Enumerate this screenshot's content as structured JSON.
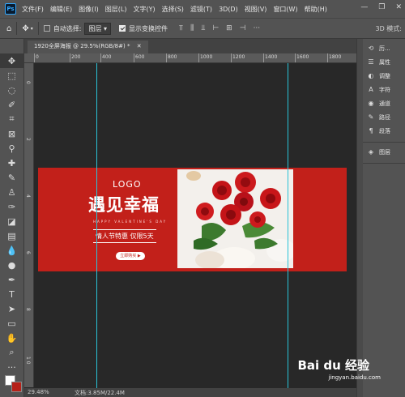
{
  "app": {
    "logo": "Ps"
  },
  "menu": [
    "文件(F)",
    "编辑(E)",
    "图像(I)",
    "图层(L)",
    "文字(Y)",
    "选择(S)",
    "滤镜(T)",
    "3D(D)",
    "视图(V)",
    "窗口(W)",
    "帮助(H)"
  ],
  "window_controls": {
    "minimize": "—",
    "restore": "❐",
    "close": "✕"
  },
  "options": {
    "auto_select_label": "自动选择:",
    "auto_select_checked": false,
    "target_value": "图层",
    "show_transform_label": "显示变换控件",
    "show_transform_checked": true,
    "more": "···",
    "mode_3d": "3D 模式:"
  },
  "document": {
    "tab_title": "1920全屏海报 @ 29.5%(RGB/8#) *",
    "zoom": "29.48%",
    "doc_size": "文档:3.85M/22.4M",
    "ruler_top": [
      "0",
      "200",
      "400",
      "600",
      "800",
      "1000",
      "1200",
      "1400",
      "1600",
      "1800"
    ],
    "ruler_left": [
      "0",
      "2",
      "4",
      "6",
      "8",
      "1 0"
    ]
  },
  "banner": {
    "logo_text": "LOGO",
    "title": "遇见幸福",
    "subtitle": "HAPPY VALENTINE'S DAY",
    "offer": "情人节特惠 仅限5天",
    "button": "立即购买 ▶"
  },
  "colors": {
    "banner_red": "#c2201a",
    "guide": "#29c3d8",
    "foreground": "#ffffff",
    "background": "#b52119"
  },
  "panels": {
    "group1": [
      {
        "icon": "history-icon",
        "glyph": "⟲",
        "label": "历..."
      },
      {
        "icon": "properties-icon",
        "glyph": "☰",
        "label": "属性"
      },
      {
        "icon": "adjustments-icon",
        "glyph": "◐",
        "label": "调整"
      },
      {
        "icon": "character-icon",
        "glyph": "A",
        "label": "字符"
      },
      {
        "icon": "channels-icon",
        "glyph": "◉",
        "label": "通道"
      },
      {
        "icon": "paths-icon",
        "glyph": "✎",
        "label": "路径"
      },
      {
        "icon": "paragraph-icon",
        "glyph": "¶",
        "label": "段落"
      }
    ],
    "group2": [
      {
        "icon": "layers-icon",
        "glyph": "◈",
        "label": "图层"
      }
    ]
  },
  "watermark": {
    "logo": "Bai du 经验",
    "url": "jingyan.baidu.com"
  }
}
